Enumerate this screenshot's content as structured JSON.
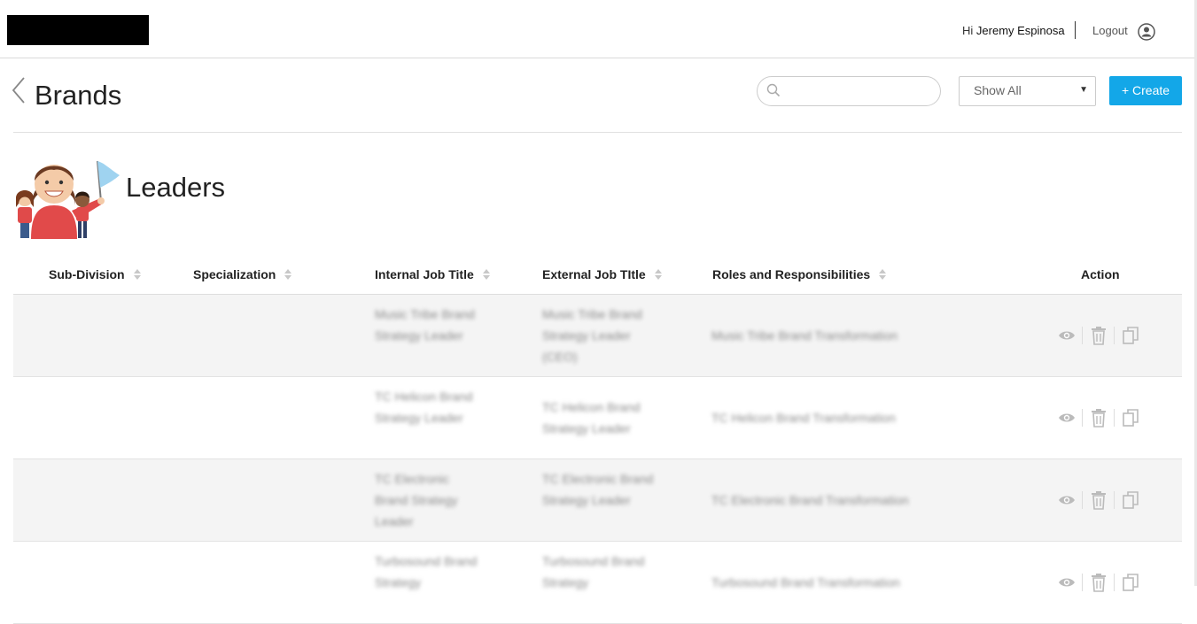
{
  "header": {
    "greeting_prefix": "Hi",
    "user_name": "Jeremy Espinosa",
    "logout_label": "Logout"
  },
  "page": {
    "title": "Brands",
    "search_placeholder": "",
    "filter_value": "Show All",
    "create_label": "+ Create",
    "accent_color": "#13a7e8"
  },
  "section": {
    "title": "Leaders"
  },
  "table": {
    "columns": [
      "Sub-Division",
      "Specialization",
      "Internal Job Title",
      "External Job TItle",
      "Roles and Responsibilities",
      "Action"
    ],
    "rows": [
      {
        "sub_division": "",
        "specialization": "",
        "internal_title": "Music Tribe Brand Strategy Leader",
        "external_title": "Music Tribe Brand Strategy Leader (CEO)",
        "roles": "Music Tribe Brand Transformation"
      },
      {
        "sub_division": "",
        "specialization": "",
        "internal_title": "TC Helicon Brand Strategy Leader",
        "external_title": "TC Helicon Brand Strategy Leader",
        "roles": "TC Helicon Brand Transformation"
      },
      {
        "sub_division": "",
        "specialization": "",
        "internal_title": "TC Electronic Brand Strategy Leader",
        "external_title": "TC Electronic Brand Strategy Leader",
        "roles": "TC Electronic Brand Transformation"
      },
      {
        "sub_division": "",
        "specialization": "",
        "internal_title": "Turbosound Brand Strategy",
        "external_title": "Turbosound Brand Strategy",
        "roles": "Turbosound Brand Transformation"
      }
    ],
    "action_icons": [
      "eye-icon",
      "trash-icon",
      "copy-icon"
    ]
  }
}
